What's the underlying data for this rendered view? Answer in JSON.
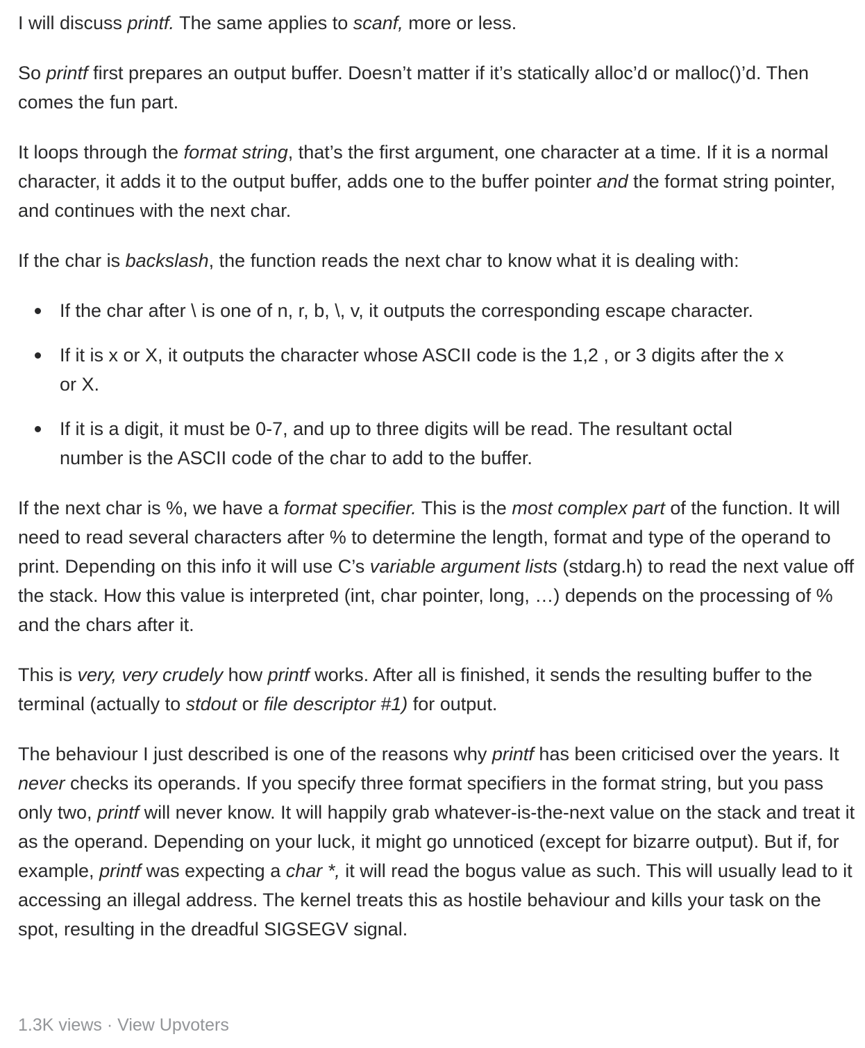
{
  "paragraphs": [
    [
      {
        "t": "I will discuss "
      },
      {
        "t": "printf.",
        "i": true
      },
      {
        "t": " The same applies to "
      },
      {
        "t": "scanf,",
        "i": true
      },
      {
        "t": " more or less."
      }
    ],
    [
      {
        "t": "So "
      },
      {
        "t": "printf",
        "i": true
      },
      {
        "t": " first prepares an output buffer. Doesn’t matter if it’s statically alloc’d or malloc()’d. Then comes the fun part."
      }
    ],
    [
      {
        "t": "It loops through the "
      },
      {
        "t": "format string",
        "i": true
      },
      {
        "t": ", that’s the first argument, one character at a time. If it is a normal character, it adds it to the output buffer, adds one to the buffer pointer "
      },
      {
        "t": "and",
        "i": true
      },
      {
        "t": " the format string pointer, and continues with the next char."
      }
    ],
    [
      {
        "t": "If the char is "
      },
      {
        "t": "backslash",
        "i": true
      },
      {
        "t": ", the function reads the next char to know what it is dealing with:"
      }
    ]
  ],
  "bullets": [
    "If the char after \\ is one of n, r, b, \\, v, it outputs the corresponding escape character.",
    "If it is x or X, it outputs the character whose ASCII code is the 1,2 , or 3 digits after the x or X.",
    "If it is a digit, it must be 0-7, and up to three digits will be read. The resultant octal number is the ASCII code of the char to add to the buffer."
  ],
  "paragraphs_after": [
    [
      {
        "t": "If the next char is %, we have a "
      },
      {
        "t": "format specifier.",
        "i": true
      },
      {
        "t": " This is the "
      },
      {
        "t": "most complex part",
        "i": true
      },
      {
        "t": " of the function. It will need to read several characters after % to determine the length, format and type of the operand to print. Depending on this info it will use C’s "
      },
      {
        "t": "variable argument lists",
        "i": true
      },
      {
        "t": " (stdarg.h) to read the next value off the stack. How this value is interpreted (int, char pointer, long, …) depends on the processing of % and the chars after it."
      }
    ],
    [
      {
        "t": "This is "
      },
      {
        "t": "very, very crudely",
        "i": true
      },
      {
        "t": " how "
      },
      {
        "t": "printf",
        "i": true
      },
      {
        "t": " works. After all is finished, it sends the resulting buffer to the terminal (actually to "
      },
      {
        "t": "stdout",
        "i": true
      },
      {
        "t": " or "
      },
      {
        "t": "file descriptor #1)",
        "i": true
      },
      {
        "t": " for output."
      }
    ],
    [
      {
        "t": "The behaviour I just described is one of the reasons why "
      },
      {
        "t": "printf",
        "i": true
      },
      {
        "t": " has been criticised over the years. It "
      },
      {
        "t": "never",
        "i": true
      },
      {
        "t": " checks its operands. If you specify three format specifiers in the format string, but you pass only two, "
      },
      {
        "t": "printf",
        "i": true
      },
      {
        "t": " will never know. It will happily grab whatever-is-the-next value on the stack and treat it as the operand. Depending on your luck, it might go unnoticed (except for bizarre output). But if, for example, "
      },
      {
        "t": "printf",
        "i": true
      },
      {
        "t": " was expecting a "
      },
      {
        "t": "char *,",
        "i": true
      },
      {
        "t": " it will read the bogus value as such. This will usually lead to it accessing an illegal address. The kernel treats this as hostile behaviour and kills your task on the spot, resulting in the dreadful SIGSEGV signal."
      }
    ]
  ],
  "footer": {
    "views": "1.3K views",
    "separator": " · ",
    "upvoters": "View Upvoters"
  },
  "colors": {
    "text": "#282829",
    "muted": "#939598"
  }
}
